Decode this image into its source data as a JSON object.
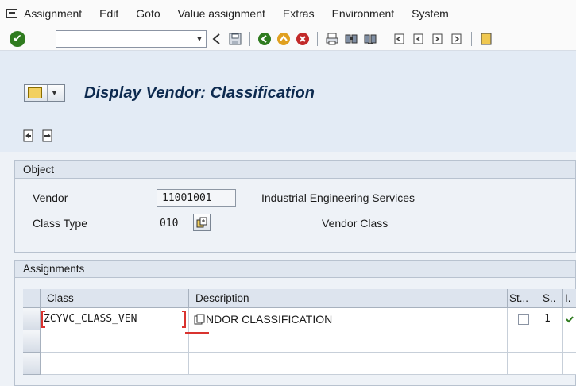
{
  "menubar": {
    "items": [
      {
        "label": "Assignment",
        "u": 0
      },
      {
        "label": "Edit",
        "u": 0
      },
      {
        "label": "Goto",
        "u": 0
      },
      {
        "label": "Value assignment",
        "u": 0
      },
      {
        "label": "Extras",
        "u": 0
      },
      {
        "label": "Environment",
        "u": 0
      },
      {
        "label": "System",
        "u": 0
      }
    ]
  },
  "toolbar": {
    "command_field_value": "",
    "icons": [
      "enter-icon",
      "save-icon",
      "back-icon",
      "exit-icon",
      "cancel-icon",
      "print-icon",
      "find-icon",
      "find-next-icon",
      "first-page-icon",
      "previous-page-icon",
      "next-page-icon",
      "last-page-icon"
    ]
  },
  "header": {
    "title": "Display Vendor: Classification"
  },
  "object": {
    "section_title": "Object",
    "vendor_label": "Vendor",
    "vendor_value": "11001001",
    "vendor_desc": "Industrial Engineering Services",
    "class_type_label": "Class Type",
    "class_type_value": "010",
    "class_type_desc": "Vendor Class"
  },
  "assignments": {
    "section_title": "Assignments",
    "columns": [
      "Class",
      "Description",
      "St...",
      "S..",
      "I."
    ],
    "rows": [
      {
        "class": "ZCYVC_CLASS_VEN",
        "description": "NDOR CLASSIFICATION",
        "status": "1"
      }
    ]
  },
  "colors": {
    "title": "#0d2a4f",
    "accent_red": "#d9332f",
    "check_green": "#2f7b1f"
  }
}
